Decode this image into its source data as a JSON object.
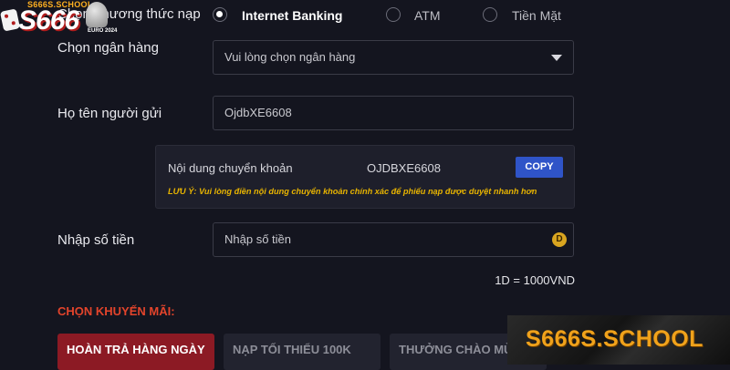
{
  "logo": {
    "site": "S666S.SCHOOL",
    "brand": "S666",
    "sub": "EURO 2024"
  },
  "payment_method": {
    "label": "Chọn phương thức nạp",
    "options": [
      {
        "label": "Internet Banking",
        "selected": true
      },
      {
        "label": "ATM",
        "selected": false
      },
      {
        "label": "Tiền Mặt",
        "selected": false
      }
    ]
  },
  "bank": {
    "label": "Chọn ngân hàng",
    "placeholder": "Vui lòng chọn ngân hàng"
  },
  "sender": {
    "label": "Họ tên người gửi",
    "value": "OjdbXE6608"
  },
  "transfer": {
    "label": "Nội dung chuyển khoản",
    "code": "OJDBXE6608",
    "copy_label": "COPY",
    "note": "LƯU Ý: Vui lòng điền nội dung chuyển khoản chính xác để phiếu nạp được duyệt nhanh hơn"
  },
  "amount": {
    "label": "Nhập số tiền",
    "placeholder": "Nhập số tiền",
    "coin": "D",
    "rate": "1D = 1000VND"
  },
  "promo": {
    "title": "CHỌN KHUYẾN MÃI:",
    "cards": [
      {
        "label": "HOÀN TRẢ HÀNG NGÀY",
        "active": true
      },
      {
        "label": "NẠP TỐI THIỂU 100K",
        "active": false
      },
      {
        "label": "THƯỞNG CHÀO MỪ",
        "active": false
      }
    ]
  },
  "watermark": "S666S.SCHOOL",
  "colors": {
    "background": "#14151f",
    "accent": "#e3442b",
    "copy_button": "#2f54c8",
    "note": "#e8b400",
    "active_card": "#8c1a24",
    "watermark": "#f0a21b"
  }
}
